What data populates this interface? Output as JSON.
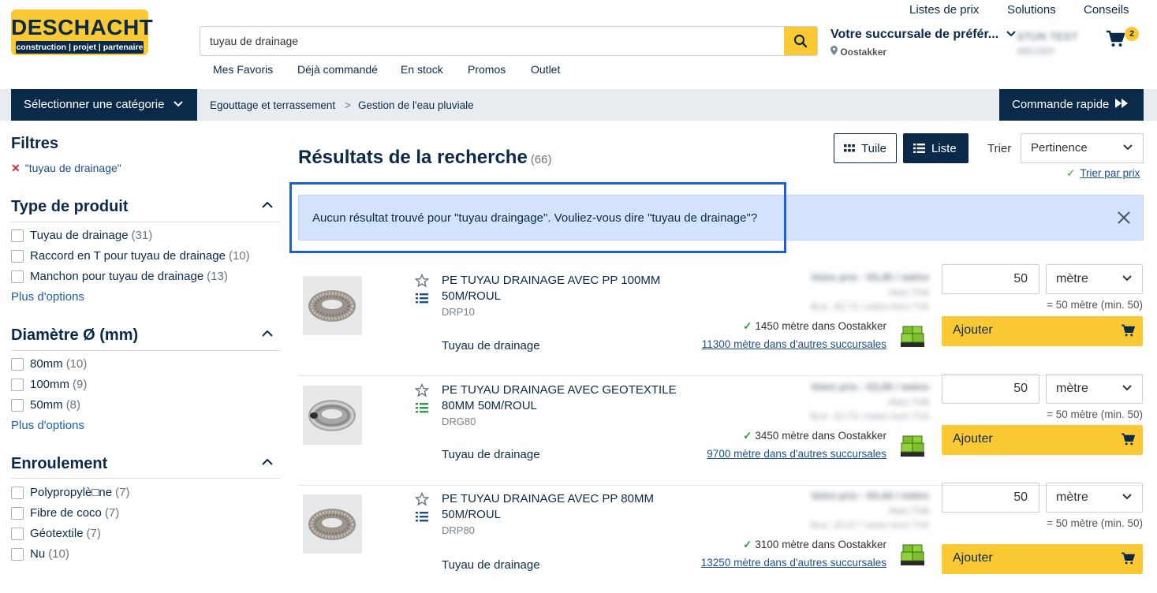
{
  "header": {
    "logo_word": "DESCHACHT",
    "logo_tagline": "construction | projet | partenaire",
    "search_value": "tuyau de drainage",
    "top_links": [
      "Listes de prix",
      "Solutions",
      "Conseils"
    ],
    "quick_nav": [
      "Mes Favoris",
      "Déjà commandé",
      "En stock",
      "Promos",
      "Outlet"
    ],
    "branch_title": "Votre succursale de préfér...",
    "branch_location": "Oostakker",
    "account_name": "STUN TEST",
    "account_sub": "ABCDEF",
    "cart_count": "2"
  },
  "category_bar": {
    "select_category": "Sélectionner une catégorie",
    "breadcrumb": [
      "Egouttage et terrassement",
      "Gestion de l'eau pluviale"
    ],
    "breadcrumb_sep": ">",
    "quick_order": "Commande rapide"
  },
  "filters": {
    "title": "Filtres",
    "active": "\"tuyau de drainage\"",
    "groups": [
      {
        "title": "Type de produit",
        "options": [
          {
            "label": "Tuyau de drainage",
            "count": "(31)"
          },
          {
            "label": "Raccord en T pour tuyau de drainage",
            "count": "(10)"
          },
          {
            "label": "Manchon pour tuyau de drainage",
            "count": "(13)"
          }
        ],
        "more": "Plus d'options"
      },
      {
        "title": "Diamètre Ø (mm)",
        "options": [
          {
            "label": "80mm",
            "count": "(10)"
          },
          {
            "label": "100mm",
            "count": "(9)"
          },
          {
            "label": "50mm",
            "count": "(8)"
          }
        ],
        "more": "Plus d'options"
      },
      {
        "title": "Enroulement",
        "options": [
          {
            "label": "Polypropylè□ne",
            "count": "(7)"
          },
          {
            "label": "Fibre de coco",
            "count": "(7)"
          },
          {
            "label": "Géotextile",
            "count": "(7)"
          },
          {
            "label": "Nu",
            "count": "(10)"
          }
        ]
      }
    ]
  },
  "results": {
    "title": "Résultats de la recherche",
    "count": "(66)",
    "view_tile": "Tuile",
    "view_list": "Liste",
    "sort_label": "Trier",
    "sort_value": "Pertinence",
    "sort_by_price": "Trier par prix",
    "alert": "Aucun résultat trouvé pour \"tuyau draingage\". Vouliez-vous dire \"tuyau de drainage\"?"
  },
  "products": [
    {
      "name": "PE TUYAU DRAINAGE AVEC PP 100MM 50M/ROUL",
      "code": "DRP10",
      "type": "Tuyau de drainage",
      "price_line1": "Votre prix : €0,45 / mètre",
      "price_line2": "Hors TVA",
      "price_line3": "Brut : €0,73 / mètre Hors TVA",
      "stock_local": "1450 mètre dans Oostakker",
      "stock_other": "11300 mètre dans d'autres succursales",
      "qty": "50",
      "unit": "mètre",
      "min_qty": "= 50 mètre (min. 50)",
      "add": "Ajouter"
    },
    {
      "name": "PE TUYAU DRAINAGE AVEC GEOTEXTILE 80MM 50M/ROUL",
      "code": "DRG80",
      "type": "Tuyau de drainage",
      "price_line1": "Votre prix : €2,06 / mètre",
      "price_line2": "Hors TVA",
      "price_line3": "Brut : €2,79 / mètre Hors TVA",
      "stock_local": "3450 mètre dans Oostakker",
      "stock_other": "9700 mètre dans d'autres succursales",
      "qty": "50",
      "unit": "mètre",
      "min_qty": "= 50 mètre (min. 50)",
      "add": "Ajouter"
    },
    {
      "name": "PE TUYAU DRAINAGE AVEC PP 80MM 50M/ROUL",
      "code": "DRP80",
      "type": "Tuyau de drainage",
      "price_line1": "Votre prix : €0,44 / mètre",
      "price_line2": "Hors TVA",
      "price_line3": "Brut : €0,67 / mètre Hors TVA",
      "stock_local": "3100 mètre dans Oostakker",
      "stock_other": "13250 mètre dans d'autres succursales",
      "qty": "50",
      "unit": "mètre",
      "min_qty": "= 50 mètre (min. 50)",
      "add": "Ajouter"
    }
  ],
  "colors": {
    "navy": "#0b2a4a",
    "brand_yellow": "#fbc933",
    "alert_bg": "#d3e3fb",
    "highlight": "#1d5fd6",
    "stock_green": "#2c9a4a"
  }
}
